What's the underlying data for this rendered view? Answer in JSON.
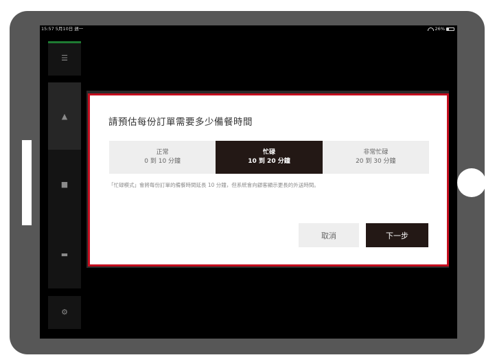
{
  "status_bar": {
    "time_date": "15:57 5月10日 週一",
    "battery": "26%",
    "battery_level": 0.26
  },
  "rail": {
    "top_icon": "menu-icon",
    "icons": [
      "bell-icon",
      "receipt-icon",
      "printer-icon",
      "settings-icon"
    ]
  },
  "modal": {
    "title": "請預估每份訂單需要多少備餐時間",
    "options": [
      {
        "title": "正常",
        "subtitle": "0 到 10 分鐘"
      },
      {
        "title": "忙碌",
        "subtitle": "10 到 20 分鐘"
      },
      {
        "title": "非常忙碌",
        "subtitle": "20 到 30 分鐘"
      }
    ],
    "selected_index": 1,
    "note": "「忙碌模式」會將每份訂單的備餐時間延長 10 分鐘，但系統會向顧客顯示更長的外送時間。",
    "cancel_label": "取消",
    "next_label": "下一步"
  },
  "colors": {
    "accent_red": "#c40d1e",
    "selected_bg": "#231815",
    "rail_green": "#1e7b32"
  }
}
